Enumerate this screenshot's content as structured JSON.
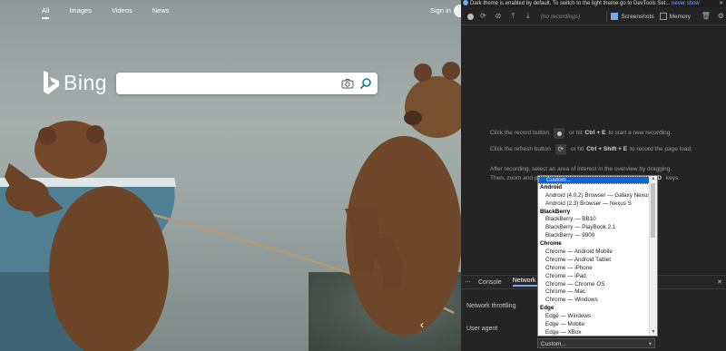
{
  "bing": {
    "nav": [
      "All",
      "Images",
      "Videos",
      "News"
    ],
    "signin": "Sign in",
    "logo_text": "Bing",
    "icons": {
      "camera": "camera-icon",
      "search": "search-icon"
    }
  },
  "devtools": {
    "infobar": {
      "text": "Dark theme is enabled by default. To switch to the light theme go to DevTools Set...",
      "link": "never show"
    },
    "toolbar": {
      "filter_placeholder": "(no recordings)",
      "screenshots_label": "Screenshots",
      "memory_label": "Memory"
    },
    "hints": {
      "record_pre": "Click the record button",
      "record_mid": "or hit",
      "record_key": "Ctrl + E",
      "record_post": "to start a new recording.",
      "refresh_pre": "Click the refresh button",
      "refresh_mid": "or hit",
      "refresh_key": "Ctrl + Shift + E",
      "refresh_post": "to record the page load.",
      "after1": "After recording, select an area of interest in the overview by dragging.",
      "after2": "Then, zoom and pan the timeline with the mousewheel or",
      "after2_key": "WASD",
      "after2_post": "keys."
    },
    "drawer": {
      "tabs": [
        "Console",
        "Network conditions"
      ],
      "network_throttling_label": "Network throttling",
      "user_agent_label": "User agent",
      "ua_selected": "Custom..."
    }
  },
  "ua_options": [
    {
      "type": "opt",
      "label": "Custom...",
      "selected": true
    },
    {
      "type": "grp",
      "label": "Android"
    },
    {
      "type": "opt",
      "label": "Android (4.0.2) Browser — Galaxy Nexus"
    },
    {
      "type": "opt",
      "label": "Android (2.3) Browser — Nexus S"
    },
    {
      "type": "grp",
      "label": "BlackBerry"
    },
    {
      "type": "opt",
      "label": "BlackBerry — BB10"
    },
    {
      "type": "opt",
      "label": "BlackBerry — PlayBook 2.1"
    },
    {
      "type": "opt",
      "label": "BlackBerry — 9900"
    },
    {
      "type": "grp",
      "label": "Chrome"
    },
    {
      "type": "opt",
      "label": "Chrome — Android Mobile"
    },
    {
      "type": "opt",
      "label": "Chrome — Android Tablet"
    },
    {
      "type": "opt",
      "label": "Chrome — iPhone"
    },
    {
      "type": "opt",
      "label": "Chrome — iPad"
    },
    {
      "type": "opt",
      "label": "Chrome — Chrome OS"
    },
    {
      "type": "opt",
      "label": "Chrome — Mac"
    },
    {
      "type": "opt",
      "label": "Chrome — Windows"
    },
    {
      "type": "grp",
      "label": "Edge"
    },
    {
      "type": "opt",
      "label": "Edge — Windows"
    },
    {
      "type": "opt",
      "label": "Edge — Mobile"
    },
    {
      "type": "opt",
      "label": "Edge — XBox"
    }
  ]
}
